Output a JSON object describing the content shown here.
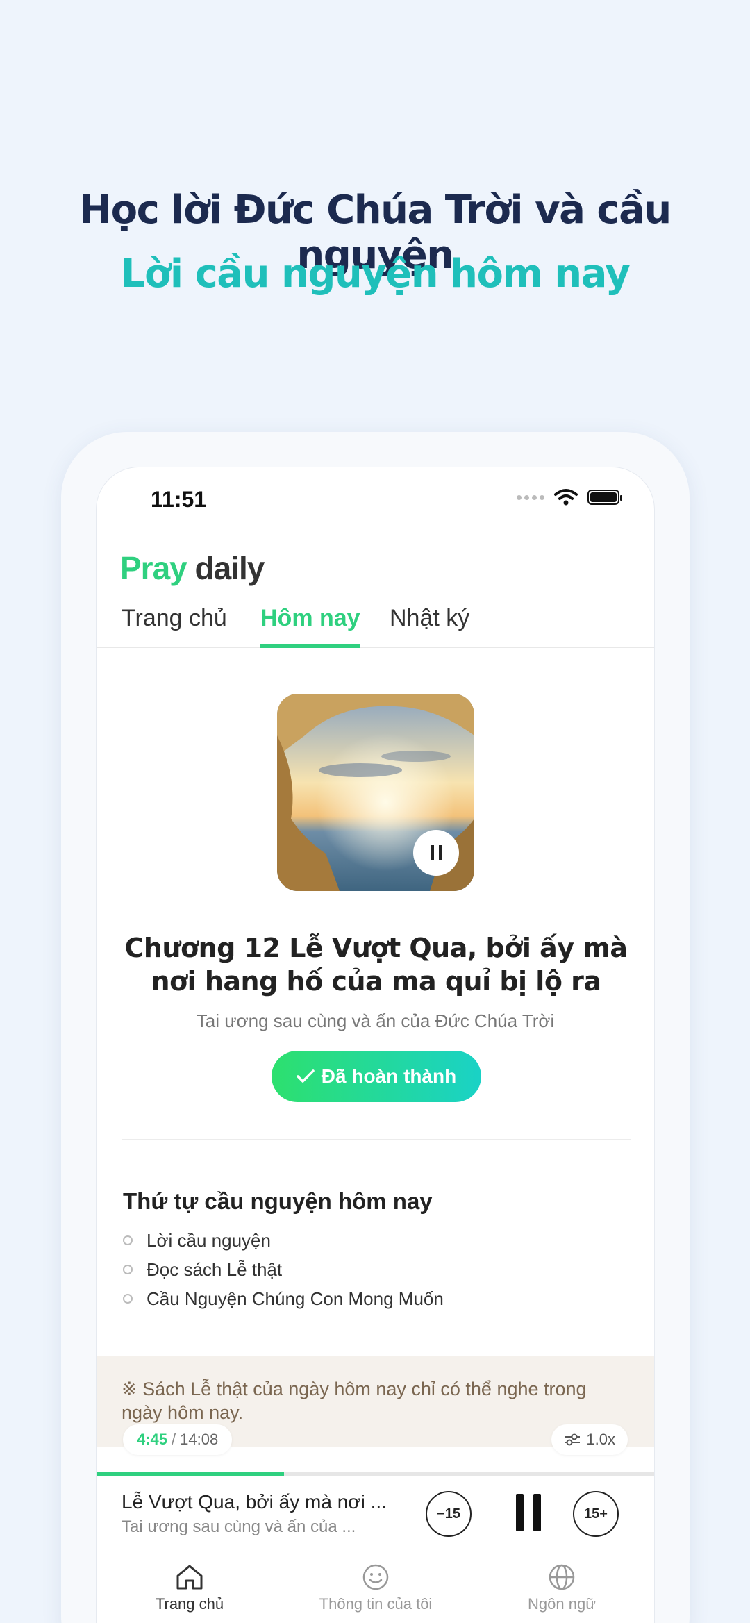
{
  "promo": {
    "headline": "Học lời Đức Chúa Trời và cầu nguyện",
    "subheadline": "Lời cầu nguyện hôm nay"
  },
  "status_bar": {
    "time": "11:51"
  },
  "app": {
    "logo_pray": "Pray",
    "logo_daily": "daily"
  },
  "tabs": [
    {
      "label": "Trang chủ",
      "active": false
    },
    {
      "label": "Hôm nay",
      "active": true
    },
    {
      "label": "Nhật ký",
      "active": false
    }
  ],
  "content": {
    "chapter_title": "Chương 12 Lễ Vượt Qua, bởi ấy mà nơi hang hố của ma quỉ bị lộ ra",
    "chapter_subtitle": "Tai ương sau cùng và ấn của Đức Chúa Trời",
    "done_button": "Đã hoàn thành",
    "order_title": "Thứ tự cầu nguyện hôm nay",
    "order_items": [
      "Lời cầu nguyện",
      "Đọc sách Lễ thật",
      "Cầu Nguyện Chúng Con Mong Muốn"
    ],
    "note": "※ Sách Lễ thật của ngày hôm nay chỉ có thể nghe trong ngày hôm nay."
  },
  "player": {
    "current_time": "4:45",
    "separator": "/",
    "total_time": "14:08",
    "progress": 0.336,
    "speed": "1.0x",
    "title": "Lễ Vượt Qua, bởi ấy mà nơi ...",
    "subtitle": "Tai ương sau cùng và ấn của ...",
    "rewind_label": "−15",
    "forward_label": "15+"
  },
  "bottom_nav": [
    {
      "label": "Trang chủ",
      "icon": "home-icon",
      "active": true
    },
    {
      "label": "Thông tin của tôi",
      "icon": "smile-icon",
      "active": false
    },
    {
      "label": "Ngôn ngữ",
      "icon": "globe-icon",
      "active": false
    }
  ],
  "colors": {
    "accent": "#2fd07f",
    "teal": "#1fbfba",
    "navy": "#1c2a4f"
  }
}
